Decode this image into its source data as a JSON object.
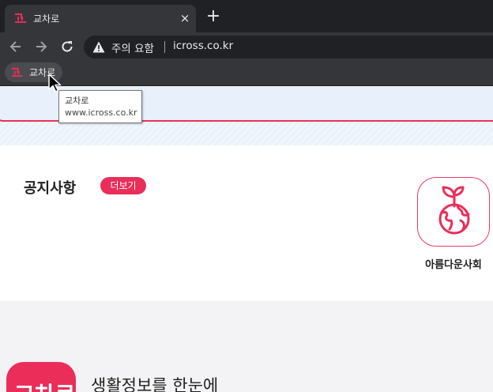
{
  "browser": {
    "tab": {
      "title": "교차로",
      "close_symbol": "×"
    },
    "new_tab_symbol": "+",
    "omnibox": {
      "security_label": "주의 요함",
      "url": "icross.co.kr"
    },
    "bookmark": {
      "label": "교차로"
    },
    "tooltip": {
      "title": "교차로",
      "url": "www.icross.co.kr"
    }
  },
  "page": {
    "notice": {
      "title": "공지사항",
      "more_label": "더보기"
    },
    "eco": {
      "label": "아름다운사회"
    },
    "promo": {
      "logo_text": "교차로",
      "headline": "생활정보를 한눈에"
    }
  },
  "colors": {
    "brand": "#ea2e59",
    "chrome_dark": "#202124",
    "chrome_toolbar": "#35363a"
  }
}
